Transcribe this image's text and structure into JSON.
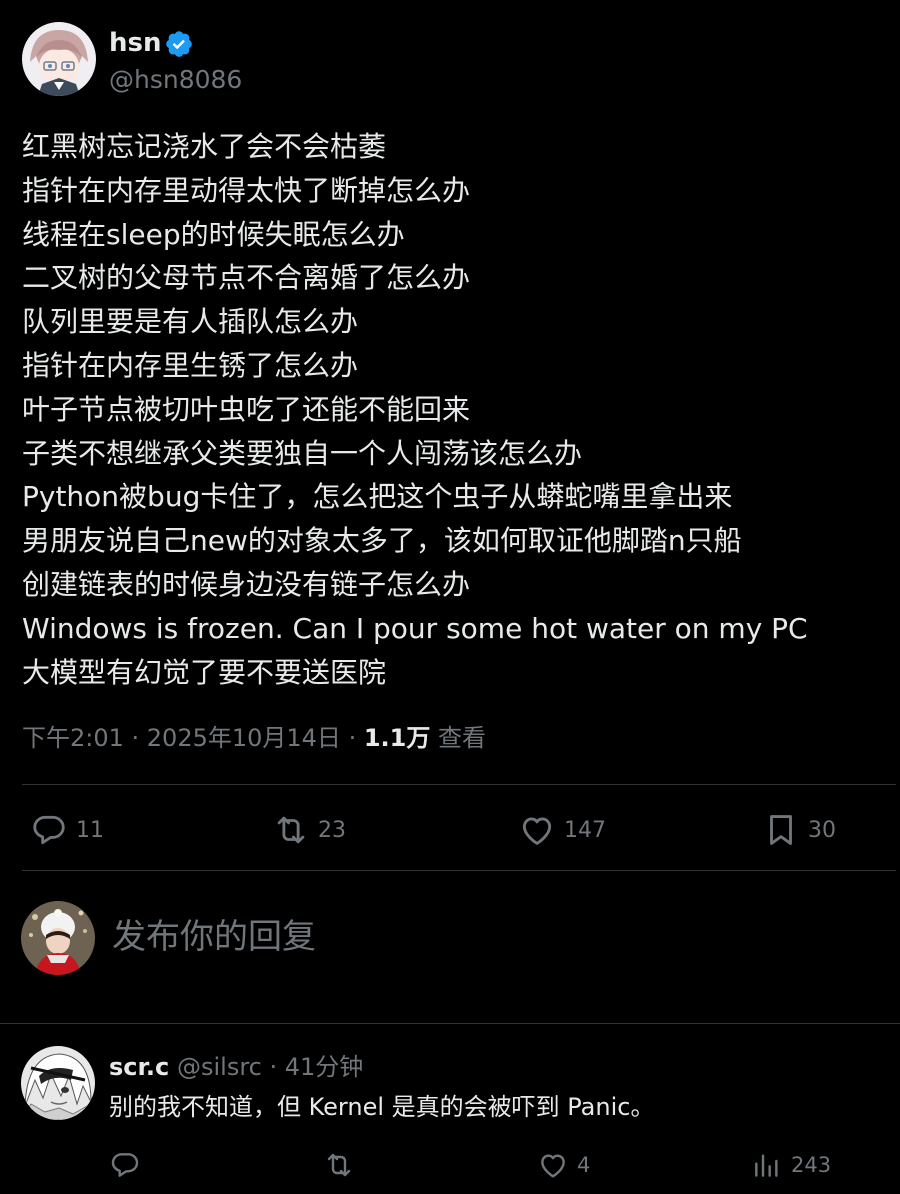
{
  "author": {
    "name": "hsn",
    "handle": "@hsn8086",
    "verified": true
  },
  "post": {
    "lines": [
      "红黑树忘记浇水了会不会枯萎",
      "指针在内存里动得太快了断掉怎么办",
      "线程在sleep的时候失眠怎么办",
      "二叉树的父母节点不合离婚了怎么办",
      "队列里要是有人插队怎么办",
      "指针在内存里生锈了怎么办",
      "叶子节点被切叶虫吃了还能不能回来",
      "子类不想继承父类要独自一个人闯荡该怎么办",
      "Python被bug卡住了，怎么把这个虫子从蟒蛇嘴里拿出来",
      "男朋友说自己new的对象太多了，该如何取证他脚踏n只船",
      "创建链表的时候身边没有链子怎么办",
      "Windows is frozen. Can I pour some hot water on my PC",
      "大模型有幻觉了要不要送医院"
    ]
  },
  "meta": {
    "timestamp": "下午2:01 · 2025年10月14日 · ",
    "views": "1.1万",
    "views_label": " 查看"
  },
  "actions": {
    "reply_count": "11",
    "repost_count": "23",
    "like_count": "147",
    "bookmark_count": "30"
  },
  "composer": {
    "placeholder": "发布你的回复"
  },
  "reply": {
    "name": "scr.c",
    "meta": "@silsrc · 41分钟",
    "text": "别的我不知道，但 Kernel 是真的会被吓到 Panic。",
    "like_count": "4",
    "views_count": "243"
  },
  "colors": {
    "background": "#000000",
    "text": "#e7e9ea",
    "muted": "#71767b",
    "divider": "#2f3336",
    "verified": "#1d9bf0"
  },
  "icons": [
    "verified-badge-icon",
    "reply-icon",
    "repost-icon",
    "like-icon",
    "bookmark-icon",
    "views-icon"
  ]
}
